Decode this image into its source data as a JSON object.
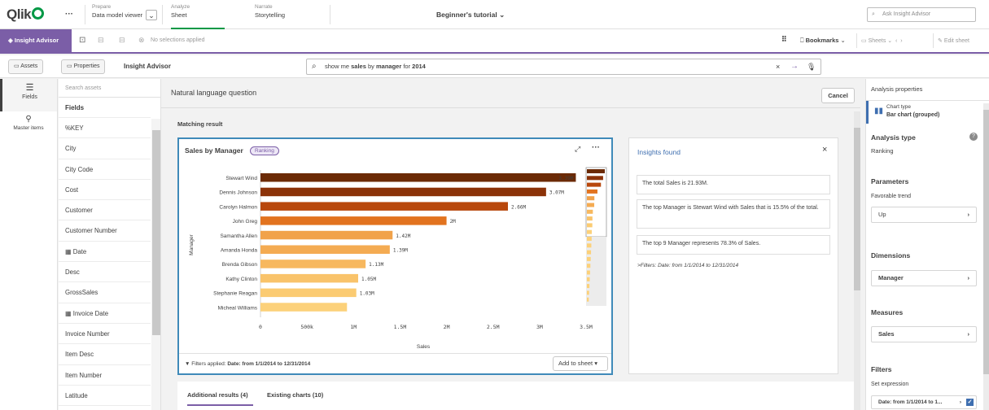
{
  "topbar": {
    "logo": "Qlik",
    "more": "···",
    "prepare": {
      "small": "Prepare",
      "big": "Data model viewer"
    },
    "analyze": {
      "small": "Analyze",
      "big": "Sheet"
    },
    "narrate": {
      "small": "Narrate",
      "big": "Storytelling"
    },
    "app_title": "Beginner's tutorial",
    "search_placeholder": "Ask Insight Advisor"
  },
  "subbar": {
    "insight_advisor": "Insight Advisor",
    "selections": "No selections applied",
    "bookmarks": "Bookmarks",
    "sheets": "Sheets",
    "edit_sheet": "Edit sheet"
  },
  "toolrow": {
    "assets": "Assets",
    "properties": "Properties",
    "title": "Insight Advisor",
    "query_prefix": "show me ",
    "query_b1": "sales",
    "query_mid1": " by ",
    "query_b2": "manager",
    "query_mid2": " for ",
    "query_b3": "2014"
  },
  "rail": {
    "fields": "Fields",
    "master_items": "Master items"
  },
  "assets": {
    "search_placeholder": "Search assets",
    "header": "Fields",
    "fields": [
      "%KEY",
      "City",
      "City Code",
      "Cost",
      "Customer",
      "Customer Number",
      "Date",
      "Desc",
      "GrossSales",
      "Invoice Date",
      "Invoice Number",
      "Item Desc",
      "Item Number",
      "Latitude"
    ]
  },
  "center": {
    "nlq_title": "Natural language question",
    "cancel": "Cancel",
    "matching": "Matching result",
    "chart_title": "Sales by Manager",
    "badge": "Ranking",
    "filters_label": "Filters applied:",
    "filters_value": "Date: from 1/1/2014 to 12/31/2014",
    "add_to_sheet": "Add to sheet",
    "tab_additional": "Additional results (4)",
    "tab_existing": "Existing charts (10)"
  },
  "insights": {
    "title": "Insights found",
    "items": [
      "The total Sales is 21.93M.",
      "The top Manager is Stewart Wind with Sales that is 15.5% of the total.",
      "The top 9 Manager represents 78.3% of Sales."
    ],
    "filters_note": ">Filters: Date: from 1/1/2014 to 12/31/2014"
  },
  "right": {
    "header": "Analysis properties",
    "chart_type_label": "Chart type",
    "chart_type_value": "Bar chart (grouped)",
    "analysis_type": "Analysis type",
    "analysis_value": "Ranking",
    "parameters": "Parameters",
    "favorable": "Favorable trend",
    "favorable_value": "Up",
    "dimensions": "Dimensions",
    "dimension_value": "Manager",
    "measures": "Measures",
    "measure_value": "Sales",
    "filters": "Filters",
    "set_expression": "Set expression",
    "filter_value": "Date: from 1/1/2014 to 1..."
  },
  "colors": {
    "accent": "#7b5ea7",
    "brand_green": "#009845",
    "chart_border": "#3f8ab9"
  },
  "chart_data": {
    "type": "bar",
    "orientation": "horizontal",
    "title": "Sales by Manager",
    "xlabel": "Sales",
    "ylabel": "Manager",
    "categories": [
      "Stewart Wind",
      "Dennis Johnson",
      "Carolyn Halmon",
      "John Greg",
      "Samantha Allen",
      "Amanda Honda",
      "Brenda Gibson",
      "Kathy Clinton",
      "Stephanie Reagan",
      "Micheal Williams"
    ],
    "values": [
      3.39,
      3.07,
      2.66,
      2.0,
      1.42,
      1.39,
      1.13,
      1.05,
      1.03,
      0.93
    ],
    "value_labels": [
      "3.39M",
      "3.07M",
      "2.66M",
      "2M",
      "1.42M",
      "1.39M",
      "1.13M",
      "1.05M",
      "1.03M",
      ""
    ],
    "x_ticks": [
      "0",
      "500k",
      "1M",
      "1.5M",
      "2M",
      "2.5M",
      "3M",
      "3.5M"
    ],
    "xlim": [
      0,
      3.5
    ],
    "bar_colors": [
      "#6b2a05",
      "#8b3208",
      "#b8470c",
      "#e2731f",
      "#f1a24a",
      "#f4ab52",
      "#f7b85f",
      "#f9c36a",
      "#fbcb72",
      "#fcd17a"
    ]
  }
}
